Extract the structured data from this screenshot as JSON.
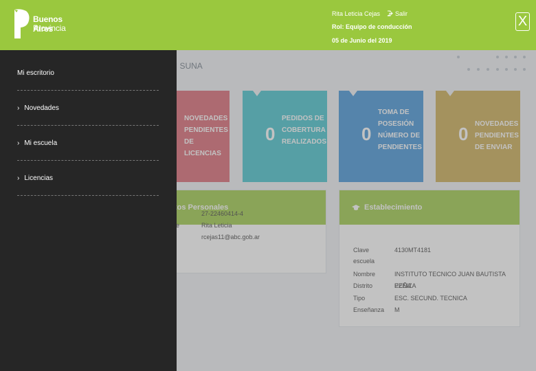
{
  "header": {
    "logo_line1": "Buenos Aires",
    "logo_line2": "Provincia",
    "user_name": "Rita Leticia Cejas",
    "logout_label": "Salir",
    "role": "Rol: Equipo de conducción",
    "date": "05 de Junio del 2019",
    "close_label": "X"
  },
  "page": {
    "title": "a | SUNA"
  },
  "cards": [
    {
      "num": "",
      "label": "NOVEDADES PENDIENTES DE LICENCIAS"
    },
    {
      "num": "0",
      "label": "PEDIDOS DE COBERTURA REALIZADOS"
    },
    {
      "num": "0",
      "label": "TOMA DE POSESIÓN NÚMERO DE PENDIENTES"
    },
    {
      "num": "0",
      "label": "NOVEDADES PENDIENTES DE ENVIAR"
    }
  ],
  "personal": {
    "title": "tos Personales",
    "cuil": "27-22460414-4",
    "nombre_key": "e",
    "nombre": "Rita Leticia",
    "email": "rcejas11@abc.gob.ar"
  },
  "establecimiento": {
    "title": "Establecimiento",
    "rows": [
      {
        "k": "Clave escuela",
        "v": "4130MT4181"
      },
      {
        "k": "Nombre",
        "v": "INSTITUTO TECNICO JUAN BAUTISTA PEÑA"
      },
      {
        "k": "Distrito",
        "v": "EZEIZA"
      },
      {
        "k": "Tipo",
        "v": "ESC. SECUND. TECNICA"
      },
      {
        "k": "Enseñanza",
        "v": "M"
      }
    ]
  },
  "sidebar": {
    "items": [
      {
        "label": "Mi escritorio"
      },
      {
        "label": "Novedades"
      },
      {
        "label": "Mi escuela"
      },
      {
        "label": "Licencias"
      }
    ]
  },
  "colors": {
    "header": "#9ac83e",
    "sidebar": "#262626",
    "card1": "#d95f6c",
    "card2": "#3bbfca",
    "card3": "#3a8fd6",
    "card4": "#c8a84a"
  }
}
